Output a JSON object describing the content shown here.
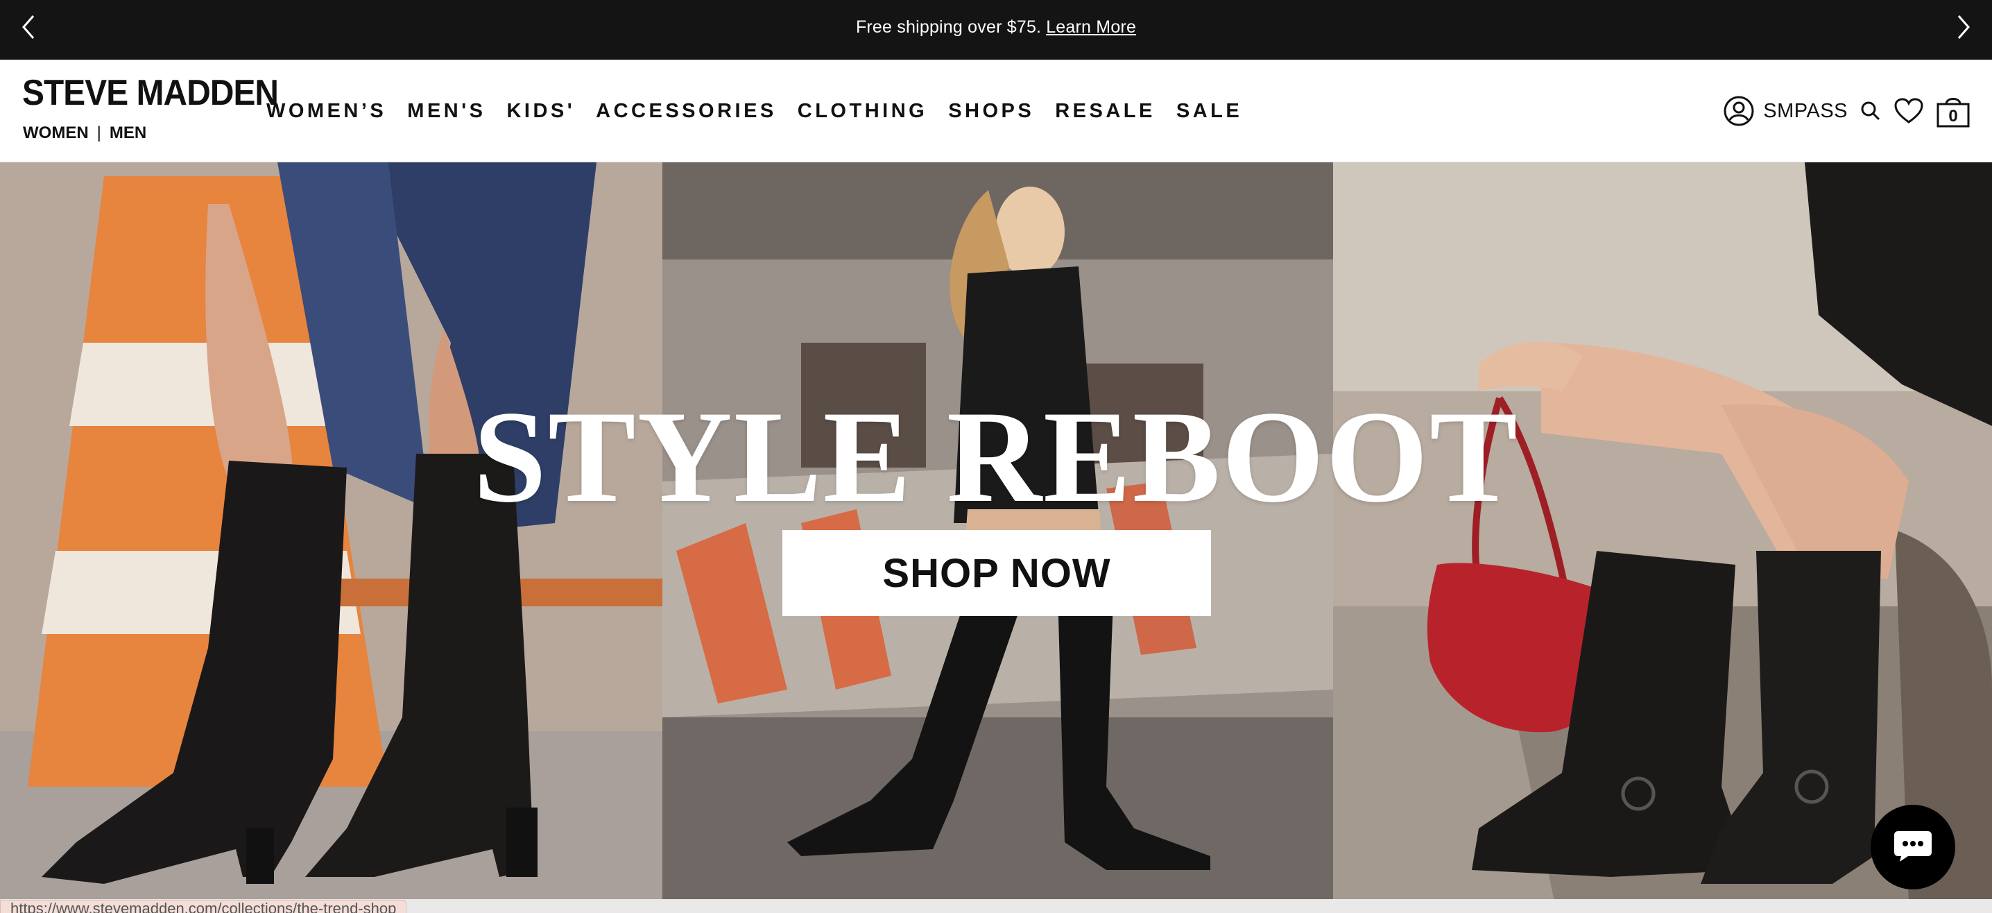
{
  "announcement": {
    "message": "Free shipping over $75.",
    "link": "Learn More",
    "prev_icon": "chevron-left-icon",
    "next_icon": "chevron-right-icon"
  },
  "brand": {
    "logo": "STEVE MADDEN",
    "gender_women": "WOMEN",
    "gender_sep": "|",
    "gender_men": "MEN"
  },
  "nav": {
    "items": [
      "WOMEN’S",
      "MEN'S",
      "KIDS'",
      "ACCESSORIES",
      "CLOTHING",
      "SHOPS",
      "RESALE",
      "SALE"
    ]
  },
  "utilities": {
    "account_label": "SMPASS",
    "account_icon": "user-circle-icon",
    "search_icon": "search-icon",
    "wishlist_icon": "heart-icon",
    "bag_icon": "shopping-bag-icon",
    "bag_count": "0"
  },
  "hero": {
    "headline": "STYLE REBOOT",
    "cta": "SHOP NOW"
  },
  "status_bar": {
    "url": "https://www.stevemadden.com/collections/the-trend-shop"
  },
  "chat": {
    "icon": "chat-bubble-icon"
  },
  "colors": {
    "announcement_bg": "#141414",
    "text": "#111111",
    "cta_bg": "#ffffff",
    "bag_red": "#b8232b"
  }
}
